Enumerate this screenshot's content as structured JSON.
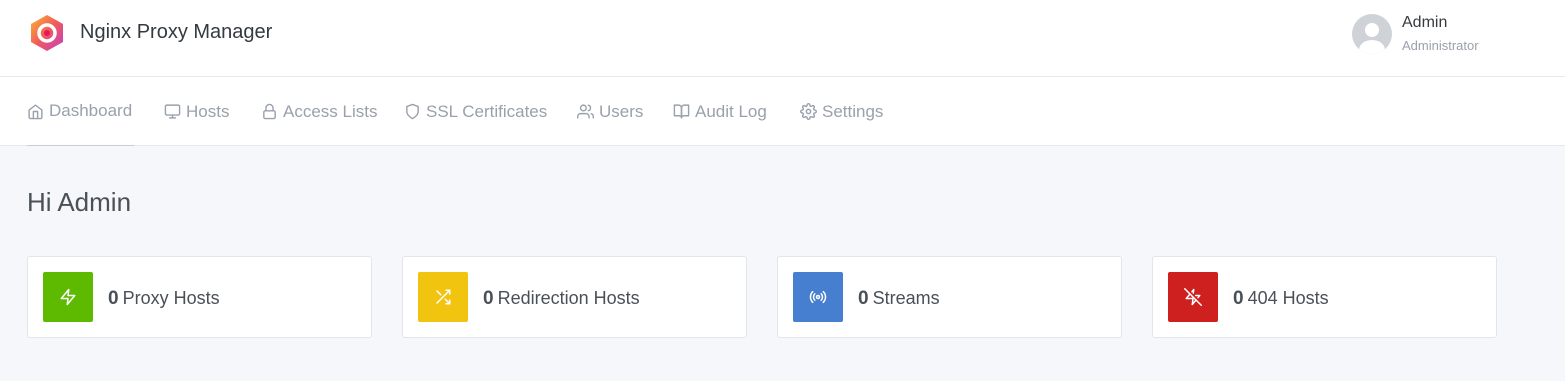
{
  "app": {
    "title": "Nginx Proxy Manager",
    "logo_icon": "npm-hexagon-logo"
  },
  "user": {
    "name": "Admin",
    "role": "Administrator",
    "avatar_icon": "user-avatar-placeholder"
  },
  "nav": [
    {
      "label": "Dashboard",
      "icon": "home-icon"
    },
    {
      "label": "Hosts",
      "icon": "monitor-icon"
    },
    {
      "label": "Access Lists",
      "icon": "lock-icon"
    },
    {
      "label": "SSL Certificates",
      "icon": "shield-icon"
    },
    {
      "label": "Users",
      "icon": "users-icon"
    },
    {
      "label": "Audit Log",
      "icon": "book-icon"
    },
    {
      "label": "Settings",
      "icon": "gear-icon"
    }
  ],
  "active_nav": "Dashboard",
  "greeting": "Hi Admin",
  "cards": [
    {
      "count": "0",
      "label": "Proxy Hosts",
      "icon": "zap-icon",
      "color": "#5eba00"
    },
    {
      "count": "0",
      "label": "Redirection Hosts",
      "icon": "shuffle-icon",
      "color": "#f1c40f"
    },
    {
      "count": "0",
      "label": "Streams",
      "icon": "radio-icon",
      "color": "#467fcf"
    },
    {
      "count": "0",
      "label": "404 Hosts",
      "icon": "zap-off-icon",
      "color": "#cd201f"
    }
  ]
}
